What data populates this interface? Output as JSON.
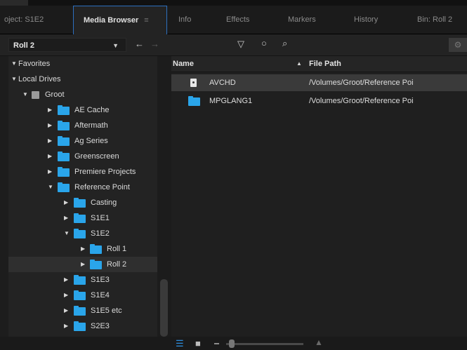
{
  "tabs": [
    {
      "label": "oject: S1E2"
    },
    {
      "label": "Media Browser",
      "menu": "≡"
    },
    {
      "label": "Info"
    },
    {
      "label": "Effects"
    },
    {
      "label": "Markers"
    },
    {
      "label": "History"
    },
    {
      "label": "Bin: Roll 2"
    }
  ],
  "toolbar": {
    "location": "Roll 2",
    "search_value": "",
    "icons": [
      "dropdown-caret",
      "back-arrow-icon",
      "forward-arrow-icon",
      "filter-icon",
      "view-icon",
      "search-icon",
      "settings-icon"
    ]
  },
  "tree": {
    "rows": [
      {
        "label": "Favorites",
        "expanded": true
      },
      {
        "label": "Local Drives",
        "expanded": true
      },
      {
        "label": "Groot",
        "expanded": true,
        "type": "drive"
      },
      {
        "label": "AE Cache",
        "expanded": false
      },
      {
        "label": "Aftermath",
        "expanded": false
      },
      {
        "label": "Ag Series",
        "expanded": false
      },
      {
        "label": "Greenscreen",
        "expanded": false
      },
      {
        "label": "Premiere Projects",
        "expanded": false
      },
      {
        "label": "Reference Point",
        "expanded": true
      },
      {
        "label": "Casting",
        "expanded": false
      },
      {
        "label": "S1E1",
        "expanded": false
      },
      {
        "label": "S1E2",
        "expanded": true
      },
      {
        "label": "Roll 1",
        "expanded": false
      },
      {
        "label": "Roll 2",
        "expanded": false,
        "selected": true
      },
      {
        "label": "S1E3",
        "expanded": false
      },
      {
        "label": "S1E4",
        "expanded": false
      },
      {
        "label": "S1E5 etc",
        "expanded": false
      },
      {
        "label": "S2E3",
        "expanded": false
      }
    ]
  },
  "files": {
    "header": {
      "name": "Name",
      "path": "File Path"
    },
    "rows": [
      {
        "name": "AVCHD",
        "path": "/Volumes/Groot/Reference Poi",
        "type": "document",
        "selected": true
      },
      {
        "name": "MPGLANG1",
        "path": "/Volumes/Groot/Reference Poi",
        "type": "folder",
        "selected": false
      }
    ]
  },
  "colors": {
    "accent": "#2d6fbf",
    "folder": "#2aa5ea",
    "panel": "#232323"
  }
}
